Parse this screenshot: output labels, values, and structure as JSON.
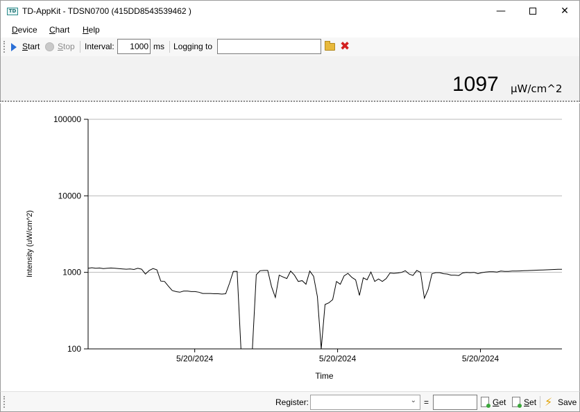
{
  "window": {
    "title": "TD-AppKit - TDSN0700 (415DD8543539462 )",
    "icon_label": "TD",
    "controls": {
      "minimize": "—",
      "close": "✕"
    }
  },
  "menu": {
    "items": [
      {
        "first": "D",
        "rest": "evice"
      },
      {
        "first": "C",
        "rest": "hart"
      },
      {
        "first": "H",
        "rest": "elp"
      }
    ]
  },
  "toolbar": {
    "start": {
      "first": "S",
      "rest": "tart"
    },
    "stop": {
      "first": "S",
      "rest": "top"
    },
    "interval_label": "Interval:",
    "interval_value": "1000",
    "interval_unit": "ms",
    "logging_label": "Logging to",
    "logging_path": ""
  },
  "reading": {
    "value": "1097",
    "unit": "μW/cm^2"
  },
  "chart_data": {
    "type": "line",
    "ylabel": "Intensity (uW/cm^2)",
    "xlabel": "Time",
    "yscale": "log",
    "ylim": [
      100,
      100000
    ],
    "yticks": [
      "100",
      "1000",
      "10000",
      "100000"
    ],
    "xticks": [
      "5/20/2024",
      "5/20/2024",
      "5/20/2024"
    ],
    "grid": "horizontal",
    "series": [
      {
        "color": "#000000",
        "points": [
          [
            0,
            1130
          ],
          [
            1,
            1150
          ],
          [
            2,
            1130
          ],
          [
            3,
            1140
          ],
          [
            4,
            1120
          ],
          [
            5,
            1130
          ],
          [
            6,
            1140
          ],
          [
            7,
            1130
          ],
          [
            8,
            1120
          ],
          [
            9,
            1110
          ],
          [
            10,
            1100
          ],
          [
            11,
            1110
          ],
          [
            12,
            1090
          ],
          [
            13,
            1130
          ],
          [
            14,
            1100
          ],
          [
            15,
            950
          ],
          [
            16,
            1060
          ],
          [
            17,
            1120
          ],
          [
            18,
            1080
          ],
          [
            19,
            770
          ],
          [
            20,
            760
          ],
          [
            21,
            660
          ],
          [
            22,
            580
          ],
          [
            23,
            560
          ],
          [
            24,
            550
          ],
          [
            25,
            570
          ],
          [
            26,
            570
          ],
          [
            27,
            560
          ],
          [
            28,
            560
          ],
          [
            29,
            550
          ],
          [
            30,
            530
          ],
          [
            31,
            530
          ],
          [
            32,
            530
          ],
          [
            33,
            525
          ],
          [
            34,
            525
          ],
          [
            35,
            520
          ],
          [
            36,
            525
          ],
          [
            37,
            720
          ],
          [
            38,
            1030
          ],
          [
            39,
            1030
          ],
          [
            40,
            100
          ],
          [
            41,
            100
          ],
          [
            42,
            100
          ],
          [
            43,
            100
          ],
          [
            44,
            930
          ],
          [
            45,
            1050
          ],
          [
            46,
            1060
          ],
          [
            47,
            1060
          ],
          [
            48,
            650
          ],
          [
            49,
            470
          ],
          [
            50,
            920
          ],
          [
            51,
            870
          ],
          [
            52,
            830
          ],
          [
            53,
            1040
          ],
          [
            54,
            920
          ],
          [
            55,
            760
          ],
          [
            56,
            780
          ],
          [
            57,
            700
          ],
          [
            58,
            1040
          ],
          [
            59,
            890
          ],
          [
            60,
            480
          ],
          [
            61,
            100
          ],
          [
            62,
            380
          ],
          [
            63,
            400
          ],
          [
            64,
            440
          ],
          [
            65,
            760
          ],
          [
            66,
            700
          ],
          [
            67,
            900
          ],
          [
            68,
            970
          ],
          [
            69,
            860
          ],
          [
            70,
            800
          ],
          [
            71,
            500
          ],
          [
            72,
            850
          ],
          [
            73,
            800
          ],
          [
            74,
            1010
          ],
          [
            75,
            760
          ],
          [
            76,
            820
          ],
          [
            77,
            760
          ],
          [
            78,
            830
          ],
          [
            79,
            980
          ],
          [
            80,
            970
          ],
          [
            81,
            980
          ],
          [
            82,
            1000
          ],
          [
            83,
            1050
          ],
          [
            84,
            950
          ],
          [
            85,
            910
          ],
          [
            86,
            1060
          ],
          [
            87,
            1000
          ],
          [
            88,
            460
          ],
          [
            89,
            600
          ],
          [
            90,
            960
          ],
          [
            91,
            990
          ],
          [
            92,
            990
          ],
          [
            93,
            960
          ],
          [
            94,
            950
          ],
          [
            95,
            920
          ],
          [
            96,
            920
          ],
          [
            97,
            910
          ],
          [
            98,
            980
          ],
          [
            99,
            1000
          ],
          [
            100,
            990
          ],
          [
            101,
            1000
          ],
          [
            102,
            960
          ],
          [
            103,
            990
          ],
          [
            104,
            1010
          ],
          [
            105,
            1020
          ],
          [
            106,
            1020
          ],
          [
            107,
            1010
          ],
          [
            108,
            1040
          ],
          [
            109,
            1030
          ],
          [
            110,
            1030
          ],
          [
            111,
            1040
          ],
          [
            112,
            1040
          ],
          [
            113,
            1045
          ],
          [
            114,
            1050
          ],
          [
            115,
            1055
          ],
          [
            116,
            1060
          ],
          [
            117,
            1065
          ],
          [
            118,
            1070
          ],
          [
            119,
            1075
          ],
          [
            120,
            1080
          ],
          [
            121,
            1085
          ],
          [
            122,
            1090
          ],
          [
            123,
            1095
          ],
          [
            124,
            1097
          ]
        ]
      }
    ]
  },
  "statusbar": {
    "register_label": "Register:",
    "register_value": "",
    "equals": "=",
    "result_value": "",
    "get": {
      "first": "G",
      "rest": "et"
    },
    "set": {
      "first": "S",
      "rest": "et"
    },
    "save_label": "Save",
    "select_chevron": "⌄"
  }
}
